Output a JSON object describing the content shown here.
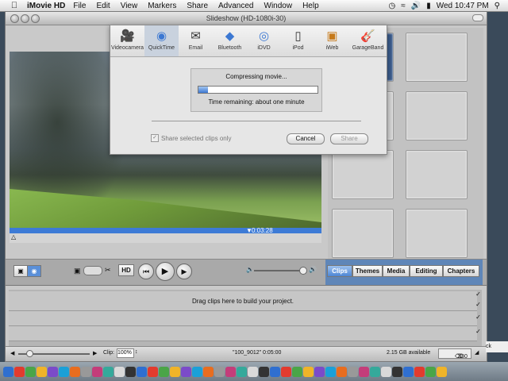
{
  "menubar": {
    "app_name": "iMovie HD",
    "items": [
      "File",
      "Edit",
      "View",
      "Markers",
      "Share",
      "Advanced",
      "Window",
      "Help"
    ],
    "clock": "Wed 10:47 PM"
  },
  "window": {
    "title": "Slideshow (HD-1080i-30)"
  },
  "viewer": {
    "timecode": "0:03:28"
  },
  "share_sheet": {
    "tabs": [
      {
        "label": "Videocamera",
        "icon": "camcorder-icon"
      },
      {
        "label": "QuickTime",
        "icon": "quicktime-icon"
      },
      {
        "label": "Email",
        "icon": "email-icon"
      },
      {
        "label": "Bluetooth",
        "icon": "bluetooth-icon"
      },
      {
        "label": "iDVD",
        "icon": "idvd-icon"
      },
      {
        "label": "iPod",
        "icon": "ipod-icon"
      },
      {
        "label": "iWeb",
        "icon": "iweb-icon"
      },
      {
        "label": "GarageBand",
        "icon": "garageband-icon"
      }
    ],
    "selected_tab": "QuickTime",
    "progress_title": "Compressing movie...",
    "progress_fraction": 0.08,
    "time_remaining": "Time remaining: about one minute",
    "checkbox_label": "Share selected clips only",
    "cancel_label": "Cancel",
    "share_label": "Share"
  },
  "controls": {
    "hd_label": "HD",
    "tabs": [
      "Clips",
      "Themes",
      "Media",
      "Editing",
      "Chapters"
    ],
    "selected_tab": "Clips"
  },
  "clip_viewer": {
    "drag_hint": "Drag clips here to build your project."
  },
  "status": {
    "clip_label": "Clip:",
    "zoom": "100%",
    "clip_info": "\"100_9012\"  0:05:00",
    "available": "2.15 GB available",
    "trash_size": "330 KB"
  },
  "peek_text": "ck",
  "colors": {
    "accent": "#3d7bd6",
    "window_bg": "#c9c9c9",
    "selected_tab": "#4d86d4"
  }
}
